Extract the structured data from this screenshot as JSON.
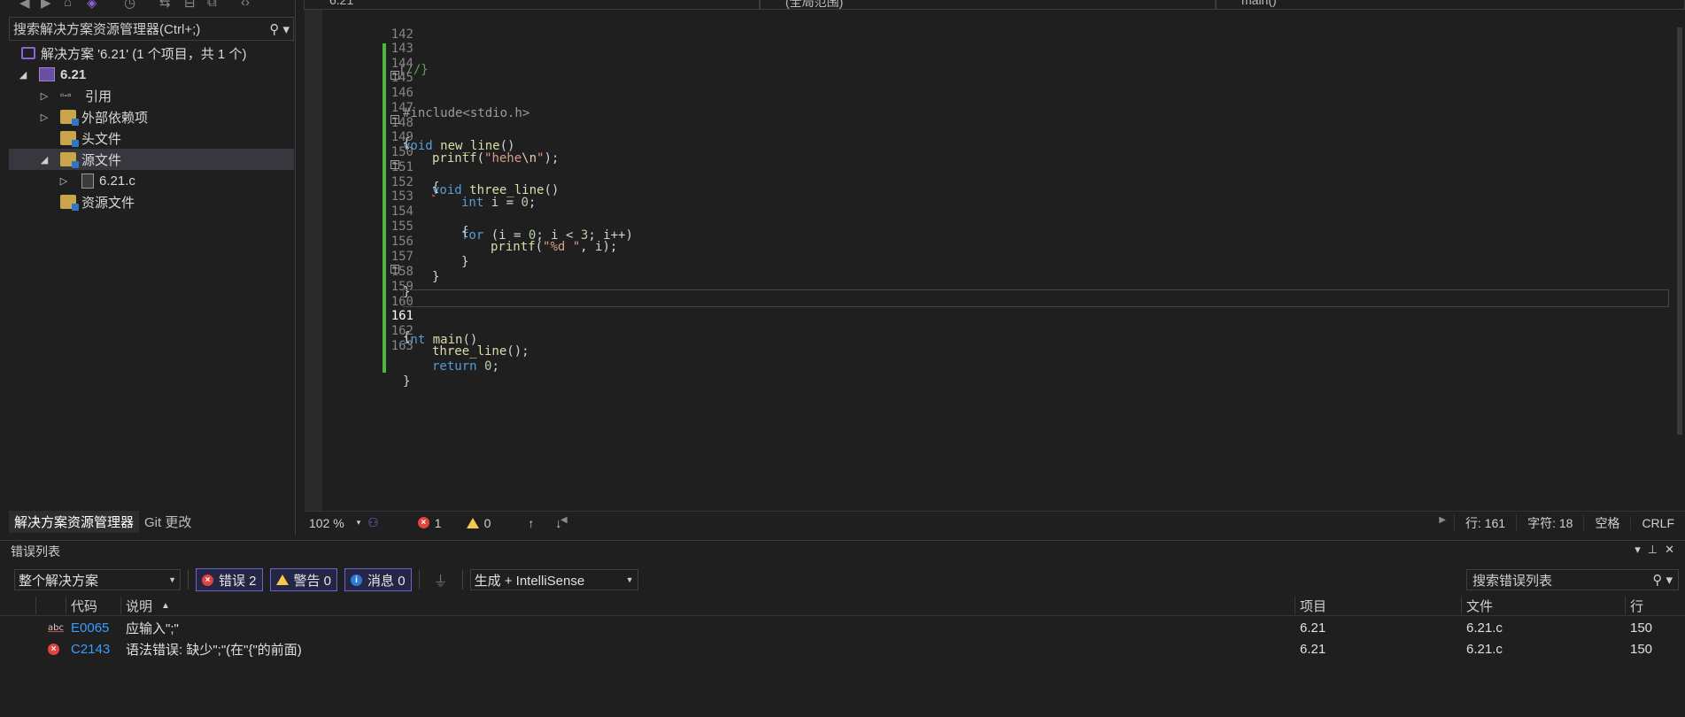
{
  "solution_explorer": {
    "search_placeholder": "搜索解决方案资源管理器(Ctrl+;)",
    "solution_label": "解决方案 '6.21' (1 个项目，共 1 个)",
    "project_label": "6.21",
    "items": [
      {
        "label": "引用"
      },
      {
        "label": "外部依赖项"
      },
      {
        "label": "头文件"
      },
      {
        "label": "源文件"
      },
      {
        "label": "6.21.c"
      },
      {
        "label": "资源文件"
      }
    ],
    "tabs": [
      "解决方案资源管理器",
      "Git 更改"
    ]
  },
  "editor": {
    "tabs": [
      "6.21",
      "(全局范围)",
      "main()"
    ],
    "lines": [
      {
        "n": "142",
        "text": "//}"
      },
      {
        "n": "143",
        "text": ""
      },
      {
        "n": "144",
        "text": ""
      },
      {
        "n": "145",
        "text": "#include<stdio.h>"
      },
      {
        "n": "146",
        "text": "void new_line()"
      },
      {
        "n": "147",
        "text": "{"
      },
      {
        "n": "148",
        "text": "printf(\"hehe\\n\");"
      },
      {
        "n": "149",
        "text": "void three_line()"
      },
      {
        "n": "150",
        "text": "{"
      },
      {
        "n": "151",
        "text": "int i = 0;"
      },
      {
        "n": "152",
        "text": "for (i = 0; i < 3; i++)"
      },
      {
        "n": "153",
        "text": "{"
      },
      {
        "n": "154",
        "text": "printf(\"%d \", i);"
      },
      {
        "n": "155",
        "text": "}"
      },
      {
        "n": "156",
        "text": "}"
      },
      {
        "n": "157",
        "text": "}"
      },
      {
        "n": "158",
        "text": ""
      },
      {
        "n": "159",
        "text": "int main()"
      },
      {
        "n": "160",
        "text": "{"
      },
      {
        "n": "161",
        "text": "three_line();"
      },
      {
        "n": "162",
        "text": "return 0;"
      },
      {
        "n": "163",
        "text": "}"
      }
    ],
    "status": {
      "zoom": "102 %",
      "errors": "1",
      "warnings": "0",
      "line": "行: 161",
      "col": "字符: 18",
      "indent": "空格",
      "eol": "CRLF"
    }
  },
  "error_list": {
    "title": "错误列表",
    "scope": "整个解决方案",
    "errors_btn": "错误 2",
    "warnings_btn": "警告 0",
    "messages_btn": "消息 0",
    "build_filter": "生成 + IntelliSense",
    "search_placeholder": "搜索错误列表",
    "columns": {
      "code": "代码",
      "desc": "说明",
      "project": "项目",
      "file": "文件",
      "line": "行"
    },
    "rows": [
      {
        "code": "E0065",
        "desc": "应输入\";\"",
        "project": "6.21",
        "file": "6.21.c",
        "line": "150"
      },
      {
        "code": "C2143",
        "desc": "语法错误: 缺少\";\"(在\"{\"的前面)",
        "project": "6.21",
        "file": "6.21.c",
        "line": "150"
      }
    ]
  },
  "colors": {
    "background": "#1f1f1f",
    "keyword": "#569cd6",
    "function": "#dcdcaa",
    "string": "#d69d85",
    "change_bar": "#4fb53f",
    "error": "#e0443e",
    "link": "#3b9cff"
  }
}
